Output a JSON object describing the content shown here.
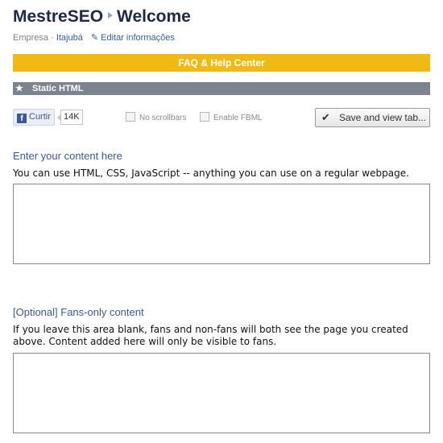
{
  "header": {
    "page_name": "MestreSEO",
    "tab_name": "Welcome",
    "category": "Empresa",
    "location": "Itajubá",
    "edit_link": "Editar informações"
  },
  "faq_bar": {
    "label": "FAQ & Help Center"
  },
  "app_bar": {
    "label": "Static HTML"
  },
  "toolbar": {
    "like_label": "Curtir",
    "like_count": "14K",
    "no_scrollbars_label": "No scrollbars",
    "enable_fbml_label": "Enable FBML",
    "save_button_label": "Save and view tab..."
  },
  "section1": {
    "heading": "Enter your content here",
    "description": "You can use HTML, CSS, JavaScript -- anything you can use on a regular webpage.",
    "value": ""
  },
  "section2": {
    "heading": "[Optional] Fans-only content",
    "description": "If you leave this area blank, fans and non-fans will both see the page you created above. Content added here will only be visible to fans.",
    "value": ""
  },
  "colors": {
    "title": "#1c2a47",
    "link": "#3b5998",
    "faq_bar": "#f0ba15",
    "app_bar": "#7c838f"
  }
}
